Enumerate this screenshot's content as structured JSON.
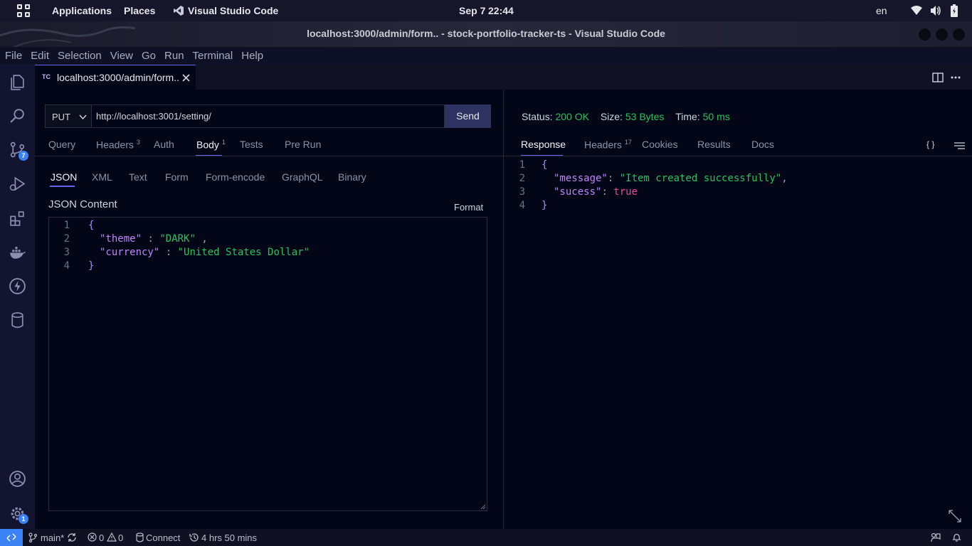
{
  "topbar": {
    "applications": "Applications",
    "places": "Places",
    "active_app": "Visual Studio Code",
    "date": "Sep 7",
    "time": "22:44",
    "lang": "en"
  },
  "window": {
    "title": "localhost:3000/admin/form.. - stock-portfolio-tracker-ts - Visual Studio Code"
  },
  "menu": [
    "File",
    "Edit",
    "Selection",
    "View",
    "Go",
    "Run",
    "Terminal",
    "Help"
  ],
  "activity_badges": {
    "source_control": "7",
    "settings": "1"
  },
  "editor_tab": {
    "badge": "TC",
    "label": "localhost:3000/admin/form.."
  },
  "request": {
    "method": "PUT",
    "url": "http://localhost:3001/setting/",
    "send_label": "Send",
    "tabs": [
      {
        "label": "Query",
        "count": ""
      },
      {
        "label": "Headers",
        "count": "3"
      },
      {
        "label": "Auth",
        "count": ""
      },
      {
        "label": "Body",
        "count": "1"
      },
      {
        "label": "Tests",
        "count": ""
      },
      {
        "label": "Pre Run",
        "count": ""
      }
    ],
    "body_tabs": [
      "JSON",
      "XML",
      "Text",
      "Form",
      "Form-encode",
      "GraphQL",
      "Binary"
    ],
    "content_label": "JSON Content",
    "format_label": "Format",
    "code": {
      "l1": "{",
      "l2_key": "\"theme\"",
      "l2_sep": " : ",
      "l2_val": "\"DARK\"",
      "l2_end": " ,",
      "l3_key": "\"currency\"",
      "l3_sep": " : ",
      "l3_val": "\"United States Dollar\"",
      "l4": "}"
    }
  },
  "response": {
    "status_label": "Status:",
    "status_value": "200 OK",
    "size_label": "Size:",
    "size_value": "53 Bytes",
    "time_label": "Time:",
    "time_value": "50 ms",
    "tabs": [
      {
        "label": "Response",
        "count": ""
      },
      {
        "label": "Headers",
        "count": "17"
      },
      {
        "label": "Cookies",
        "count": ""
      },
      {
        "label": "Results",
        "count": ""
      },
      {
        "label": "Docs",
        "count": ""
      }
    ],
    "braces_label": "{ }",
    "code": {
      "l1": "{",
      "l2_key": "\"message\"",
      "l2_sep": ": ",
      "l2_val": "\"Item created successfully\"",
      "l2_end": ",",
      "l3_key": "\"sucess\"",
      "l3_sep": ": ",
      "l3_val": "true",
      "l4": "}"
    }
  },
  "statusbar": {
    "branch": "main*",
    "errors": "0",
    "warnings": "0",
    "connect": "Connect",
    "timer": "4 hrs 50 mins"
  },
  "colors": {
    "accent": "#6366f1",
    "success": "#22c55e",
    "badge": "#3b82f6"
  }
}
